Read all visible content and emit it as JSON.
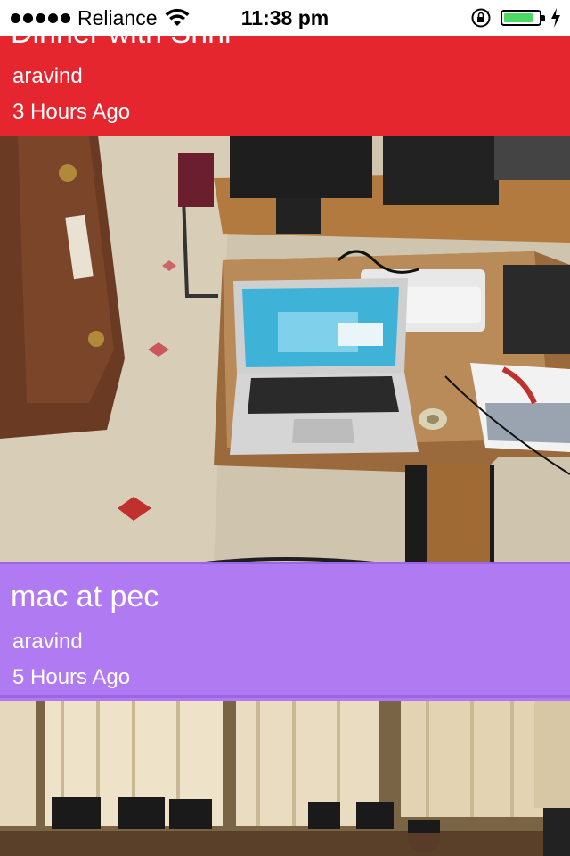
{
  "statusbar": {
    "carrier": "Reliance",
    "time": "11:38 pm",
    "battery_level": 0.85,
    "battery_color": "#4cd964"
  },
  "feed": {
    "cards": [
      {
        "title": "Dinner with Shni",
        "author": "aravind",
        "time_ago": "3 Hours Ago",
        "color": "#e5262f"
      },
      {
        "title": "mac at pec",
        "author": "aravind",
        "time_ago": "5 Hours Ago",
        "color": "#b07af2"
      }
    ]
  }
}
